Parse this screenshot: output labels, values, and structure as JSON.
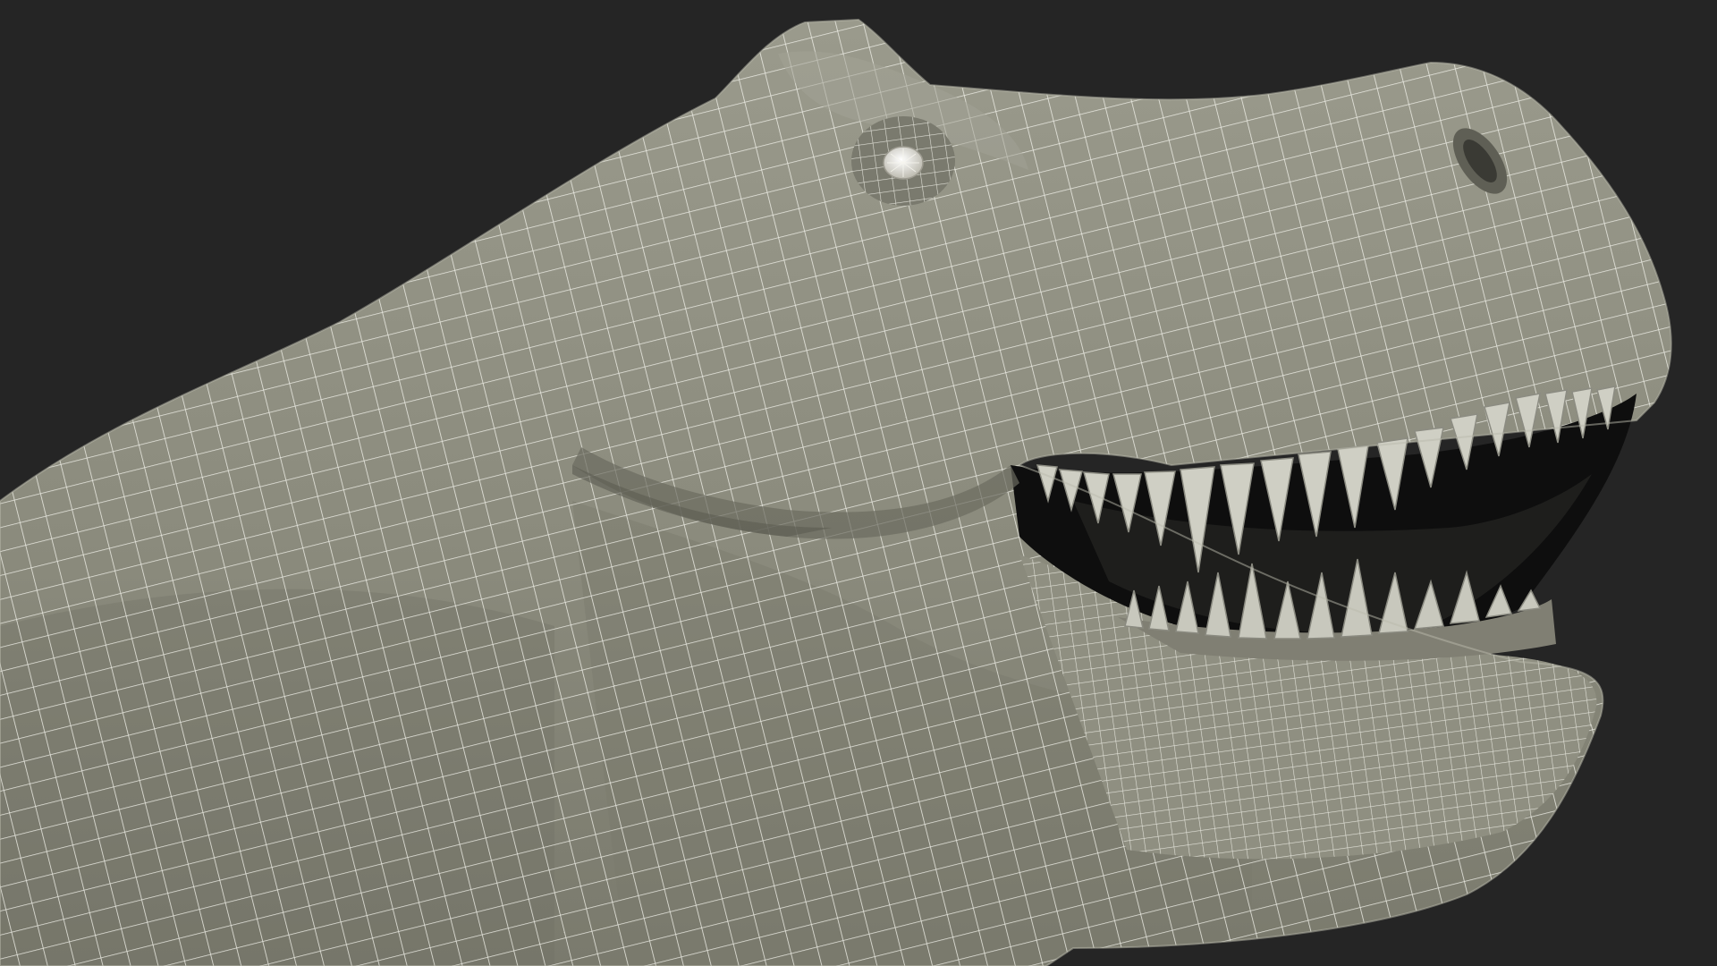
{
  "scene": {
    "subject": "t-rex-head-wireframe",
    "colors": {
      "background": "#252525",
      "skin": "#8e8e80",
      "skin_shadow": "#6f6f64",
      "wire": "#f4f4ec",
      "mouth_dark": "#0e0e0e",
      "tooth": "#cfcfc4",
      "tooth_shadow": "#8c8c82",
      "eye": "#e9e7da"
    }
  }
}
